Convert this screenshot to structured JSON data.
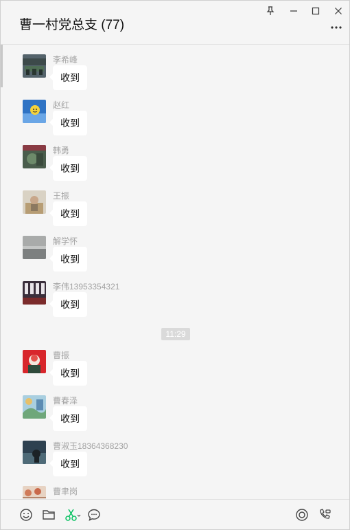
{
  "window": {
    "title": "曹一村党总支 (77)"
  },
  "messages": [
    {
      "sender": "李希峰",
      "text": "收到"
    },
    {
      "sender": "赵红",
      "text": "收到"
    },
    {
      "sender": "韩勇",
      "text": "收到"
    },
    {
      "sender": "王振",
      "text": "收到"
    },
    {
      "sender": "解学怀",
      "text": "收到"
    },
    {
      "sender": "李伟13953354321",
      "text": "收到"
    },
    {
      "sender": "曹振",
      "text": "收到"
    },
    {
      "sender": "曹春泽",
      "text": "收到"
    },
    {
      "sender": "曹淑玉18364368230",
      "text": "收到"
    },
    {
      "sender": "曹聿岗",
      "text": ""
    }
  ],
  "timestamp": "11:29",
  "toolbar": {
    "left_icons": [
      "emoji-icon",
      "folder-icon",
      "scissors-icon",
      "chat-history-icon"
    ],
    "right_icons": [
      "live-icon",
      "voice-call-icon"
    ]
  },
  "colors": {
    "accent_green": "#07c160",
    "bubble": "#ffffff",
    "background": "#f5f5f5"
  }
}
